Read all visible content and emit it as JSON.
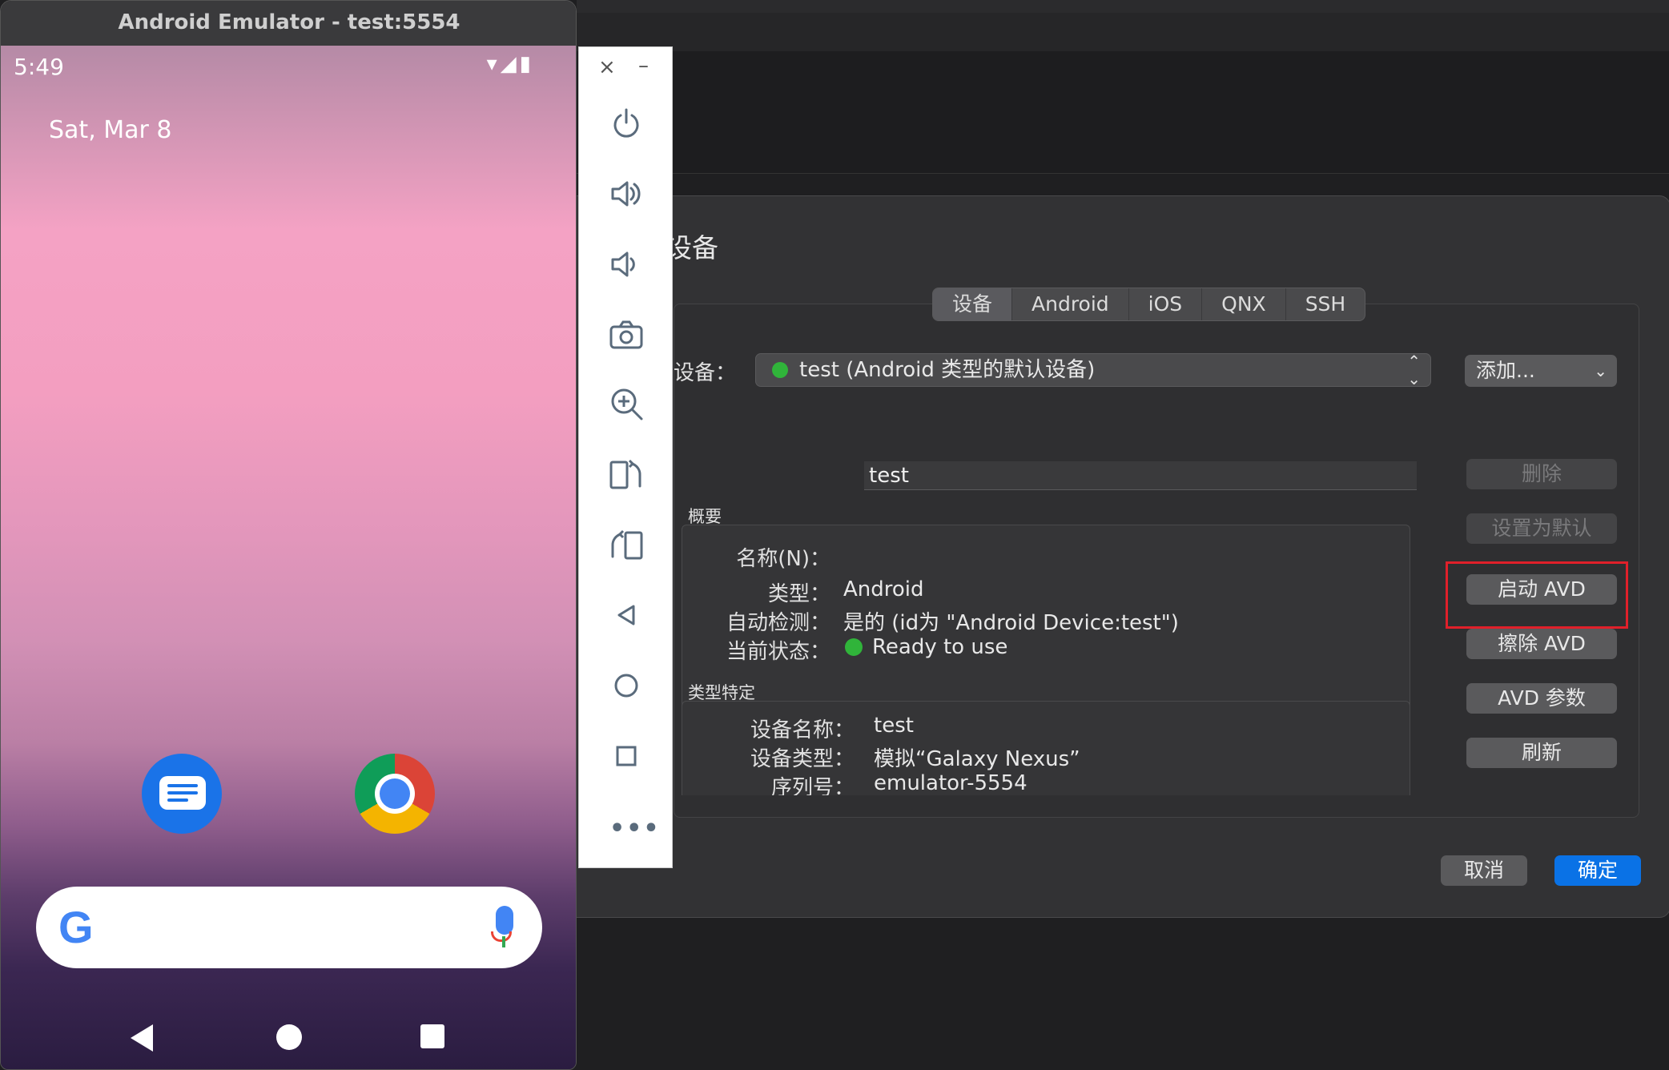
{
  "emulator": {
    "window_title": "Android Emulator - test:5554",
    "status_time": "5:49",
    "status_icons": "▾◢▮",
    "date": "Sat, Mar 8",
    "google_logo": "G"
  },
  "toolbar": {
    "close": "×",
    "minimize": "–",
    "more": "•••"
  },
  "dialog": {
    "title": "设备",
    "tabs": [
      "设备",
      "Android",
      "iOS",
      "QNX",
      "SSH"
    ],
    "device_label": "设备：",
    "device_select": "test (Android 类型的默认设备)",
    "add_button": "添加...",
    "overview": {
      "group_label": "概要",
      "name_label": "名称(N)：",
      "name_value": "test",
      "type_label": "类型：",
      "type_value": "Android",
      "autodetect_label": "自动检测：",
      "autodetect_value": "是的 (id为 \"Android Device:test\")",
      "status_label": "当前状态：",
      "status_value": "Ready to use"
    },
    "specific": {
      "group_label": "类型特定",
      "device_name_label": "设备名称：",
      "device_name_value": "test",
      "device_type_label": "设备类型：",
      "device_type_value": "模拟“Galaxy Nexus”",
      "serial_label": "序列号：",
      "serial_value": "emulator-5554"
    },
    "side_buttons": {
      "delete": "删除",
      "set_default": "设置为默认",
      "start_avd": "启动 AVD",
      "wipe_avd": "擦除 AVD",
      "avd_params": "AVD 参数",
      "refresh": "刷新"
    },
    "cancel": "取消",
    "ok": "确定"
  }
}
